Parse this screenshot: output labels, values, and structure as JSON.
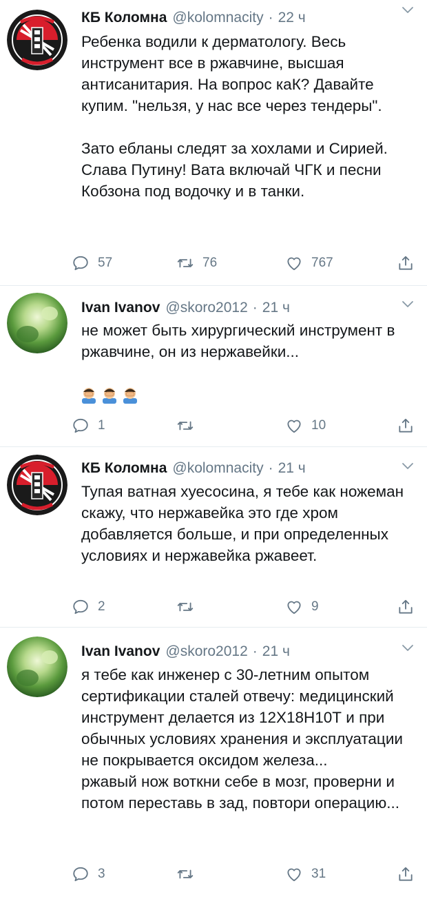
{
  "tweets": [
    {
      "avatar": "kolomna-club-logo",
      "name": "КБ Коломна",
      "handle": "@kolomnacity",
      "separator": "·",
      "time": "22 ч",
      "text": "Ребенка водили к дерматологу.  Весь инструмент все в ржавчине, высшая антисанитария. На вопрос каК? Давайте купим. \"нельзя, у нас все через тендеры\".\n\nЗато ебланы следят за хохлами и Сирией.\nСлава Путину! Вата включай ЧГК и песни Кобзона под водочку и в танки.",
      "replies": "57",
      "retweets": "76",
      "likes": "767"
    },
    {
      "avatar": "blurred-green-photo",
      "name": "Ivan Ivanov",
      "handle": "@skoro2012",
      "separator": "·",
      "time": "21 ч",
      "text": "не может быть хирургический инструмент в ржавчине, он из нержавейки...",
      "emojis": [
        "facepalm-emoji",
        "facepalm-emoji",
        "facepalm-emoji"
      ],
      "replies": "1",
      "retweets": "",
      "likes": "10"
    },
    {
      "avatar": "kolomna-club-logo",
      "name": "КБ Коломна",
      "handle": "@kolomnacity",
      "separator": "·",
      "time": "21 ч",
      "text": "Тупая ватная хуесосина, я тебе как ножеман скажу, что нержавейка это где хром добавляется больше, и при определенных условиях и нержавейка ржавеет.",
      "replies": "2",
      "retweets": "",
      "likes": "9"
    },
    {
      "avatar": "blurred-green-photo",
      "name": "Ivan Ivanov",
      "handle": "@skoro2012",
      "separator": "·",
      "time": "21 ч",
      "text": "я тебе как инженер с 30-летним опытом сертификации сталей отвечу: медицинский инструмент делается из 12Х18Н10Т и при обычных условиях хранения и эксплуатации не покрывается оксидом железа...\nржавый нож воткни себе в мозг, проверни и потом переставь в зад, повтори операцию...",
      "replies": "3",
      "retweets": "",
      "likes": "31"
    }
  ],
  "colors": {
    "text": "#14171a",
    "secondary": "#657786",
    "divider": "#e6ecf0"
  }
}
